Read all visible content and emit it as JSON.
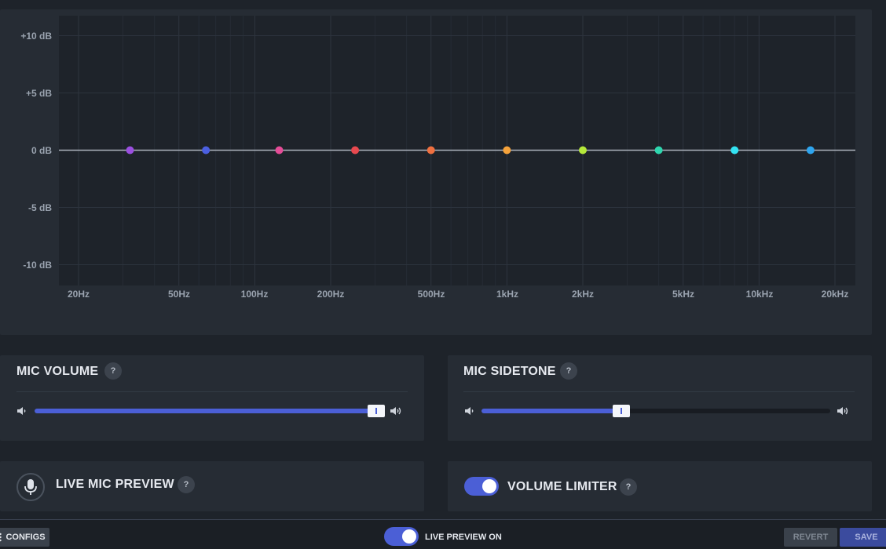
{
  "equalizer": {
    "y_labels": [
      "+10 dB",
      "+5 dB",
      "0 dB",
      "-5 dB",
      "-10 dB"
    ],
    "x_labels": [
      "20Hz",
      "50Hz",
      "100Hz",
      "200Hz",
      "500Hz",
      "1kHz",
      "2kHz",
      "5kHz",
      "10kHz",
      "20kHz"
    ],
    "bands": [
      {
        "freq_hz": 32,
        "gain_db": 0,
        "color": "#9b4fe0"
      },
      {
        "freq_hz": 64,
        "gain_db": 0,
        "color": "#4b5fe0"
      },
      {
        "freq_hz": 125,
        "gain_db": 0,
        "color": "#e54c97"
      },
      {
        "freq_hz": 250,
        "gain_db": 0,
        "color": "#e8494f"
      },
      {
        "freq_hz": 500,
        "gain_db": 0,
        "color": "#ef7040"
      },
      {
        "freq_hz": 1000,
        "gain_db": 0,
        "color": "#f5a23b"
      },
      {
        "freq_hz": 2000,
        "gain_db": 0,
        "color": "#b5e83a"
      },
      {
        "freq_hz": 4000,
        "gain_db": 0,
        "color": "#2ed6ae"
      },
      {
        "freq_hz": 8000,
        "gain_db": 0,
        "color": "#33e2f2"
      },
      {
        "freq_hz": 16000,
        "gain_db": 0,
        "color": "#2ea5ef"
      }
    ]
  },
  "mic_volume": {
    "title": "MIC VOLUME",
    "help": "?",
    "value_percent": 98
  },
  "mic_sidetone": {
    "title": "MIC SIDETONE",
    "help": "?",
    "value_percent": 40
  },
  "live_mic_preview": {
    "title": "LIVE MIC PREVIEW",
    "help": "?",
    "icon": "microphone-icon"
  },
  "volume_limiter": {
    "title": "VOLUME LIMITER",
    "help": "?",
    "enabled": true
  },
  "bottom_bar": {
    "configs_label": "CONFIGS",
    "live_preview_label": "LIVE PREVIEW ON",
    "live_preview_enabled": true,
    "revert_label": "REVERT",
    "save_label": "SAVE"
  },
  "colors": {
    "accent": "#4b5fd6",
    "background": "#1e232a",
    "panel": "#262c34"
  }
}
